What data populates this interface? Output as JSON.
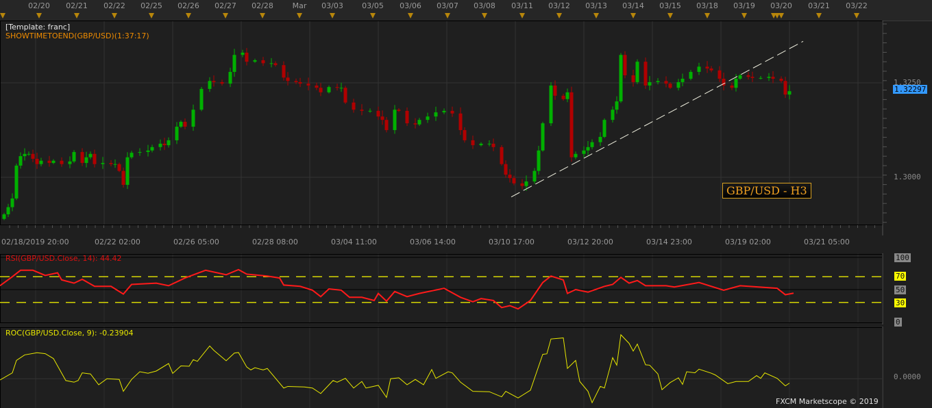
{
  "header": {
    "template": "[Template: franc]",
    "indicator_text": "SHOWTIMETOEND(GBP/USD)(1:37:17)",
    "date_labels": [
      "02/20",
      "02/21",
      "02/22",
      "02/25",
      "02/26",
      "02/27",
      "02/28",
      "Mar",
      "03/03",
      "03/05",
      "03/06",
      "03/07",
      "03/08",
      "03/11",
      "03/12",
      "03/13",
      "03/14",
      "03/15",
      "03/18",
      "03/19",
      "03/20",
      "03/21",
      "03/22"
    ]
  },
  "footer": {
    "copyright": "FXCM Marketscope © 2019"
  },
  "colors": {
    "up": "#00b000",
    "down": "#b00000",
    "rsi": "#ff1a1a",
    "roc": "#e8e800",
    "level": "#e8e800",
    "price_tag": "#3399ff"
  },
  "chart_data": [
    {
      "type": "candlestick",
      "title": "GBP/USD - H3",
      "symbol": "GBP/USD",
      "timeframe": "H3",
      "current_price": "1.32297",
      "ylim": [
        1.2875,
        1.3415
      ],
      "y_ticks": [
        "1.3250",
        "1.3000"
      ],
      "y_tick_values": [
        1.325,
        1.3
      ],
      "x_tick_labels": [
        "02/18/2019 20:00",
        "02/22 02:00",
        "02/26 05:00",
        "02/28 08:00",
        "03/04 11:00",
        "03/06 14:00",
        "03/10 17:00",
        "03/12 20:00",
        "03/14 23:00",
        "03/19 02:00",
        "03/21 05:00"
      ],
      "x_range_bars": [
        0,
        215
      ],
      "closes": [
        [
          1,
          1.2902
        ],
        [
          2,
          1.2921
        ],
        [
          3,
          1.2944
        ],
        [
          4,
          1.3031
        ],
        [
          5,
          1.3056
        ],
        [
          6,
          1.3062
        ],
        [
          7,
          1.3062
        ],
        [
          8,
          1.3049
        ],
        [
          9,
          1.3035
        ],
        [
          10,
          1.3044
        ],
        [
          12,
          1.3038
        ],
        [
          13,
          1.3044
        ],
        [
          15,
          1.3035
        ],
        [
          17,
          1.3042
        ],
        [
          18,
          1.3067
        ],
        [
          20,
          1.3038
        ],
        [
          21,
          1.3053
        ],
        [
          22,
          1.3062
        ],
        [
          23,
          1.3035
        ],
        [
          25,
          1.3038
        ],
        [
          27,
          1.3035
        ],
        [
          28,
          1.3035
        ],
        [
          29,
          1.3017
        ],
        [
          30,
          1.298
        ],
        [
          31,
          1.3053
        ],
        [
          32,
          1.3065
        ],
        [
          34,
          1.3067
        ],
        [
          36,
          1.3071
        ],
        [
          37,
          1.308
        ],
        [
          39,
          1.3089
        ],
        [
          40,
          1.3085
        ],
        [
          41,
          1.3098
        ],
        [
          43,
          1.3134
        ],
        [
          44,
          1.3147
        ],
        [
          45,
          1.3134
        ],
        [
          47,
          1.3179
        ],
        [
          49,
          1.3234
        ],
        [
          51,
          1.3255
        ],
        [
          52,
          1.3252
        ],
        [
          54,
          1.3248
        ],
        [
          56,
          1.3279
        ],
        [
          57,
          1.3324
        ],
        [
          59,
          1.333
        ],
        [
          60,
          1.3306
        ],
        [
          62,
          1.331
        ],
        [
          64,
          1.3302
        ],
        [
          66,
          1.3302
        ],
        [
          67,
          1.3297
        ],
        [
          69,
          1.3264
        ],
        [
          70,
          1.3255
        ],
        [
          72,
          1.3252
        ],
        [
          73,
          1.3248
        ],
        [
          75,
          1.3243
        ],
        [
          77,
          1.3237
        ],
        [
          78,
          1.3225
        ],
        [
          80,
          1.3239
        ],
        [
          82,
          1.3237
        ],
        [
          83,
          1.3237
        ],
        [
          84,
          1.3198
        ],
        [
          86,
          1.3179
        ],
        [
          88,
          1.3176
        ],
        [
          90,
          1.3176
        ],
        [
          92,
          1.3161
        ],
        [
          93,
          1.3152
        ],
        [
          94,
          1.3125
        ],
        [
          96,
          1.3179
        ],
        [
          97,
          1.3176
        ],
        [
          99,
          1.3143
        ],
        [
          101,
          1.314
        ],
        [
          102,
          1.3152
        ],
        [
          104,
          1.3161
        ],
        [
          106,
          1.3172
        ],
        [
          108,
          1.3176
        ],
        [
          110,
          1.3169
        ],
        [
          112,
          1.3125
        ],
        [
          113,
          1.3098
        ],
        [
          115,
          1.3085
        ],
        [
          117,
          1.3089
        ],
        [
          119,
          1.3089
        ],
        [
          120,
          1.308
        ],
        [
          122,
          1.3035
        ],
        [
          123,
          1.3007
        ],
        [
          124,
          1.2998
        ],
        [
          125,
          1.2984
        ],
        [
          127,
          1.2977
        ],
        [
          128,
          1.2989
        ],
        [
          130,
          1.3017
        ],
        [
          131,
          1.3071
        ],
        [
          132,
          1.3143
        ],
        [
          134,
          1.3243
        ],
        [
          135,
          1.3216
        ],
        [
          137,
          1.3207
        ],
        [
          138,
          1.3225
        ],
        [
          139,
          1.3053
        ],
        [
          140,
          1.3062
        ],
        [
          142,
          1.3071
        ],
        [
          143,
          1.308
        ],
        [
          144,
          1.3093
        ],
        [
          146,
          1.3107
        ],
        [
          147,
          1.3152
        ],
        [
          149,
          1.3179
        ],
        [
          150,
          1.3201
        ],
        [
          151,
          1.3324
        ],
        [
          152,
          1.327
        ],
        [
          154,
          1.3252
        ],
        [
          155,
          1.3306
        ],
        [
          157,
          1.3243
        ],
        [
          158,
          1.3252
        ],
        [
          160,
          1.3255
        ],
        [
          162,
          1.3248
        ],
        [
          163,
          1.3237
        ],
        [
          165,
          1.3252
        ],
        [
          166,
          1.3261
        ],
        [
          168,
          1.3279
        ],
        [
          170,
          1.3293
        ],
        [
          172,
          1.3288
        ],
        [
          173,
          1.3283
        ],
        [
          175,
          1.3261
        ],
        [
          176,
          1.3243
        ],
        [
          178,
          1.3237
        ],
        [
          179,
          1.3261
        ],
        [
          180,
          1.327
        ],
        [
          182,
          1.3266
        ],
        [
          183,
          1.3263
        ],
        [
          185,
          1.3263
        ],
        [
          187,
          1.3266
        ],
        [
          188,
          1.3261
        ],
        [
          190,
          1.3255
        ],
        [
          191,
          1.3219
        ],
        [
          192,
          1.3228
        ]
      ],
      "trendline": {
        "from": [
          124,
          1.2948
        ],
        "to": [
          195,
          1.336
        ]
      }
    },
    {
      "type": "line",
      "title": "RSI(GBP/USD.Close, 14): 44.42",
      "ylim": [
        0,
        100
      ],
      "y_ticks": [
        "100",
        "70",
        "50",
        "30",
        "0"
      ],
      "levels": [
        70,
        30
      ],
      "points": [
        [
          0,
          56
        ],
        [
          3,
          70
        ],
        [
          5,
          80
        ],
        [
          8,
          80
        ],
        [
          11,
          72
        ],
        [
          14,
          76
        ],
        [
          15,
          65
        ],
        [
          18,
          60
        ],
        [
          20,
          66
        ],
        [
          23,
          55
        ],
        [
          27,
          55
        ],
        [
          30,
          43
        ],
        [
          32,
          58
        ],
        [
          38,
          60
        ],
        [
          41,
          56
        ],
        [
          45,
          68
        ],
        [
          50,
          80
        ],
        [
          55,
          73
        ],
        [
          58,
          81
        ],
        [
          60,
          74
        ],
        [
          65,
          71
        ],
        [
          68,
          68
        ],
        [
          69,
          57
        ],
        [
          73,
          55
        ],
        [
          76,
          49
        ],
        [
          78,
          39
        ],
        [
          80,
          51
        ],
        [
          83,
          49
        ],
        [
          85,
          38
        ],
        [
          88,
          38
        ],
        [
          91,
          33
        ],
        [
          92,
          44
        ],
        [
          94,
          32
        ],
        [
          96,
          47
        ],
        [
          99,
          39
        ],
        [
          102,
          44
        ],
        [
          108,
          52
        ],
        [
          112,
          38
        ],
        [
          115,
          31
        ],
        [
          117,
          36
        ],
        [
          120,
          33
        ],
        [
          122,
          22
        ],
        [
          124,
          25
        ],
        [
          126,
          20
        ],
        [
          129,
          33
        ],
        [
          132,
          61
        ],
        [
          134,
          71
        ],
        [
          137,
          65
        ],
        [
          138,
          44
        ],
        [
          140,
          50
        ],
        [
          143,
          46
        ],
        [
          147,
          55
        ],
        [
          149,
          58
        ],
        [
          151,
          69
        ],
        [
          153,
          60
        ],
        [
          155,
          64
        ],
        [
          157,
          56
        ],
        [
          162,
          56
        ],
        [
          164,
          54
        ],
        [
          170,
          61
        ],
        [
          176,
          49
        ],
        [
          180,
          56
        ],
        [
          189,
          52
        ],
        [
          191,
          42
        ],
        [
          193,
          44.42
        ]
      ]
    },
    {
      "type": "line",
      "title": "ROC(GBP/USD.Close, 9): -0.23904",
      "ylim": [
        -1.6,
        2.7
      ],
      "y_ticks": [
        "0.0000"
      ],
      "points": [
        [
          0,
          -0.07
        ],
        [
          3,
          0.32
        ],
        [
          4,
          1.0
        ],
        [
          6,
          1.3
        ],
        [
          9,
          1.42
        ],
        [
          11,
          1.37
        ],
        [
          13,
          1.1
        ],
        [
          16,
          -0.1
        ],
        [
          18,
          -0.19
        ],
        [
          19,
          -0.1
        ],
        [
          20,
          0.32
        ],
        [
          22,
          0.26
        ],
        [
          24,
          -0.33
        ],
        [
          26,
          0
        ],
        [
          29,
          -0.04
        ],
        [
          30,
          -0.69
        ],
        [
          32,
          -0.04
        ],
        [
          34,
          0.38
        ],
        [
          36,
          0.3
        ],
        [
          38,
          0.42
        ],
        [
          41,
          0.83
        ],
        [
          42,
          0.29
        ],
        [
          44,
          0.7
        ],
        [
          46,
          0.68
        ],
        [
          47,
          1.04
        ],
        [
          48,
          0.95
        ],
        [
          51,
          1.79
        ],
        [
          52,
          1.55
        ],
        [
          55,
          0.98
        ],
        [
          57,
          1.4
        ],
        [
          58,
          1.43
        ],
        [
          60,
          0.64
        ],
        [
          61,
          0.48
        ],
        [
          62,
          0.6
        ],
        [
          64,
          0.48
        ],
        [
          65,
          0.56
        ],
        [
          69,
          -0.51
        ],
        [
          70,
          -0.42
        ],
        [
          74,
          -0.45
        ],
        [
          76,
          -0.51
        ],
        [
          78,
          -0.81
        ],
        [
          81,
          -0.1
        ],
        [
          82,
          -0.19
        ],
        [
          84,
          0.02
        ],
        [
          86,
          -0.51
        ],
        [
          88,
          -0.15
        ],
        [
          89,
          -0.51
        ],
        [
          92,
          -0.36
        ],
        [
          94,
          -1.02
        ],
        [
          95,
          0
        ],
        [
          97,
          0.05
        ],
        [
          99,
          -0.33
        ],
        [
          101,
          -0.04
        ],
        [
          103,
          -0.33
        ],
        [
          105,
          0.5
        ],
        [
          106,
          0.02
        ],
        [
          109,
          0.38
        ],
        [
          110,
          0.32
        ],
        [
          112,
          -0.19
        ],
        [
          115,
          -0.69
        ],
        [
          119,
          -0.71
        ],
        [
          122,
          -0.99
        ],
        [
          123,
          -0.69
        ],
        [
          126,
          -1.05
        ],
        [
          129,
          -0.63
        ],
        [
          132,
          1.33
        ],
        [
          133,
          1.36
        ],
        [
          134,
          2.17
        ],
        [
          137,
          2.23
        ],
        [
          138,
          0.56
        ],
        [
          140,
          1.0
        ],
        [
          141,
          -0.15
        ],
        [
          143,
          -0.69
        ],
        [
          144,
          -1.31
        ],
        [
          146,
          -0.42
        ],
        [
          147,
          -0.51
        ],
        [
          149,
          1.15
        ],
        [
          150,
          0.74
        ],
        [
          151,
          2.4
        ],
        [
          153,
          1.93
        ],
        [
          154,
          1.51
        ],
        [
          155,
          1.89
        ],
        [
          157,
          0.76
        ],
        [
          158,
          0.74
        ],
        [
          160,
          0.26
        ],
        [
          161,
          -0.6
        ],
        [
          163,
          -0.21
        ],
        [
          165,
          0.05
        ],
        [
          166,
          -0.31
        ],
        [
          167,
          0.38
        ],
        [
          169,
          0.32
        ],
        [
          170,
          0.52
        ],
        [
          173,
          0.3
        ],
        [
          174,
          0.2
        ],
        [
          177,
          -0.27
        ],
        [
          179,
          -0.15
        ],
        [
          182,
          -0.15
        ],
        [
          184,
          0.17
        ],
        [
          185,
          0.02
        ],
        [
          186,
          0.32
        ],
        [
          189,
          0.02
        ],
        [
          191,
          -0.39
        ],
        [
          192,
          -0.24
        ]
      ]
    }
  ]
}
